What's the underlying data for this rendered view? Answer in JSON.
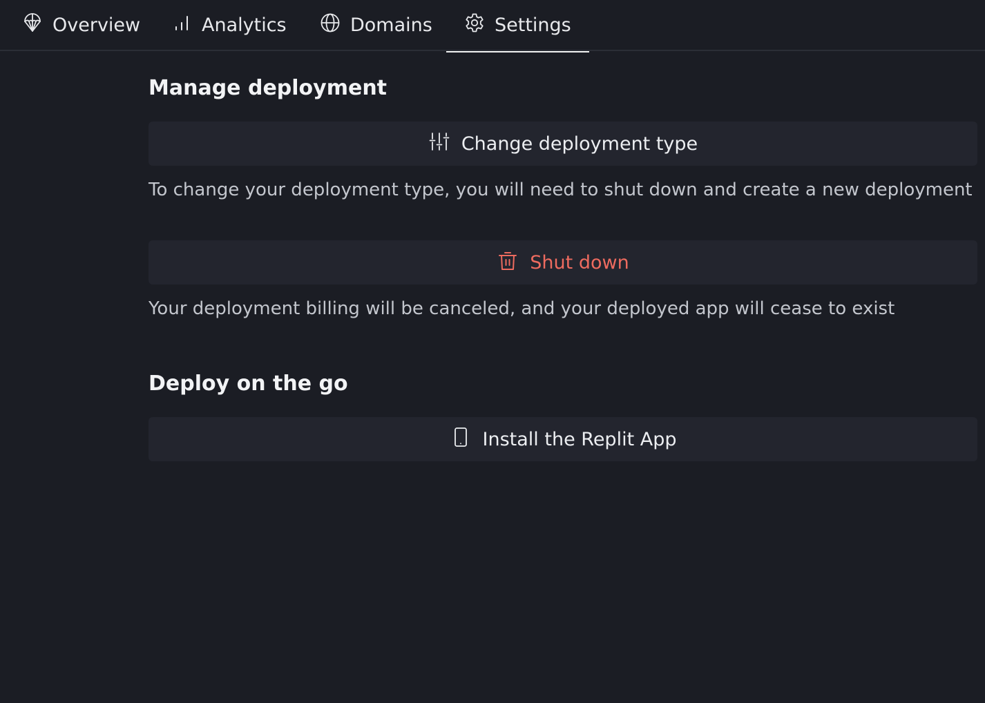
{
  "tabs": [
    {
      "label": "Overview",
      "icon": "deploy-icon",
      "active": false
    },
    {
      "label": "Analytics",
      "icon": "bar-chart-icon",
      "active": false
    },
    {
      "label": "Domains",
      "icon": "globe-icon",
      "active": false
    },
    {
      "label": "Settings",
      "icon": "gear-icon",
      "active": true
    }
  ],
  "manage": {
    "title": "Manage deployment",
    "change_type_label": "Change deployment type",
    "change_type_desc": "To change your deployment type, you will need to shut down and create a new deployment",
    "shutdown_label": "Shut down",
    "shutdown_desc": "Your deployment billing will be canceled, and your deployed app will cease to exist"
  },
  "on_the_go": {
    "title": "Deploy on the go",
    "install_label": "Install the Replit App"
  },
  "colors": {
    "background": "#1b1d24",
    "button_bg": "#23252e",
    "danger": "#ee6b5f"
  }
}
